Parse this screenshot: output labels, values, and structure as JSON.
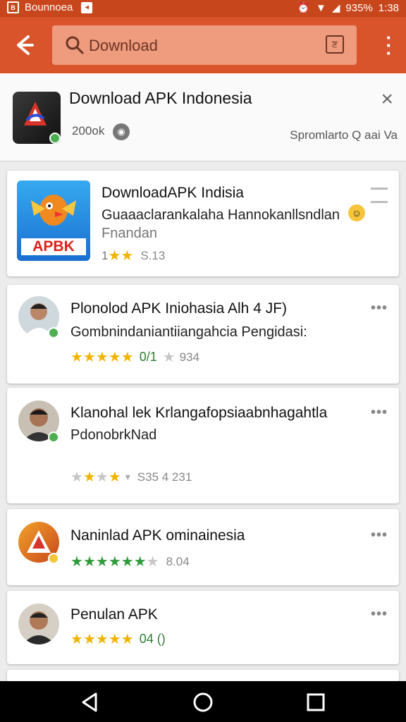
{
  "status_bar": {
    "left_text": "Bounnoea",
    "battery": "935%",
    "time": "1:38"
  },
  "search": {
    "query": "Download",
    "voice_label": "ਣ"
  },
  "top_app": {
    "title": "Download APK Indonesia",
    "subtitle": "200ok",
    "right_text": "Spromlarto Q aai Va",
    "close_label": "×"
  },
  "featured": {
    "title": "DownloadAPK Indisia",
    "line1": "Guaaaclarankalaha Hannokanllsndlan",
    "line2": "Fnandan",
    "rating_label": "1",
    "stars_on": 2,
    "count": "S.13",
    "icon_label": "APBK"
  },
  "results": [
    {
      "title": "Plonolod APK Iniohasia Alh 4 JF)",
      "line2": "Gombnindaniantiiangahcia Pengidasi:",
      "stars_on": 5,
      "stars_total": 6,
      "rating": "0/1",
      "count": "934"
    },
    {
      "title": "Klanohal lek Krlangafopsiaabnhagahtla",
      "line2": "PdonobrkNad",
      "stars_on": 3,
      "stars_total": 4,
      "rating": "",
      "count": "S35 4 231"
    },
    {
      "title": "Naninlad APK ominainesia",
      "line2": "",
      "stars_on": 6,
      "stars_total": 7,
      "rating": "",
      "count": "8.04"
    },
    {
      "title": "Penulan APK",
      "line2": "",
      "stars_on": 5,
      "stars_total": 5,
      "rating": "04 ()",
      "count": ""
    }
  ],
  "colors": {
    "accent": "#d9542a",
    "statusbar": "#c8461c",
    "star": "#f0b400",
    "star_green": "#2e9b3a"
  },
  "icons": [
    "arrow-back-icon",
    "search-icon",
    "voice-search-icon",
    "overflow-menu-icon",
    "close-icon",
    "back-nav-icon",
    "home-nav-icon",
    "recents-nav-icon"
  ]
}
